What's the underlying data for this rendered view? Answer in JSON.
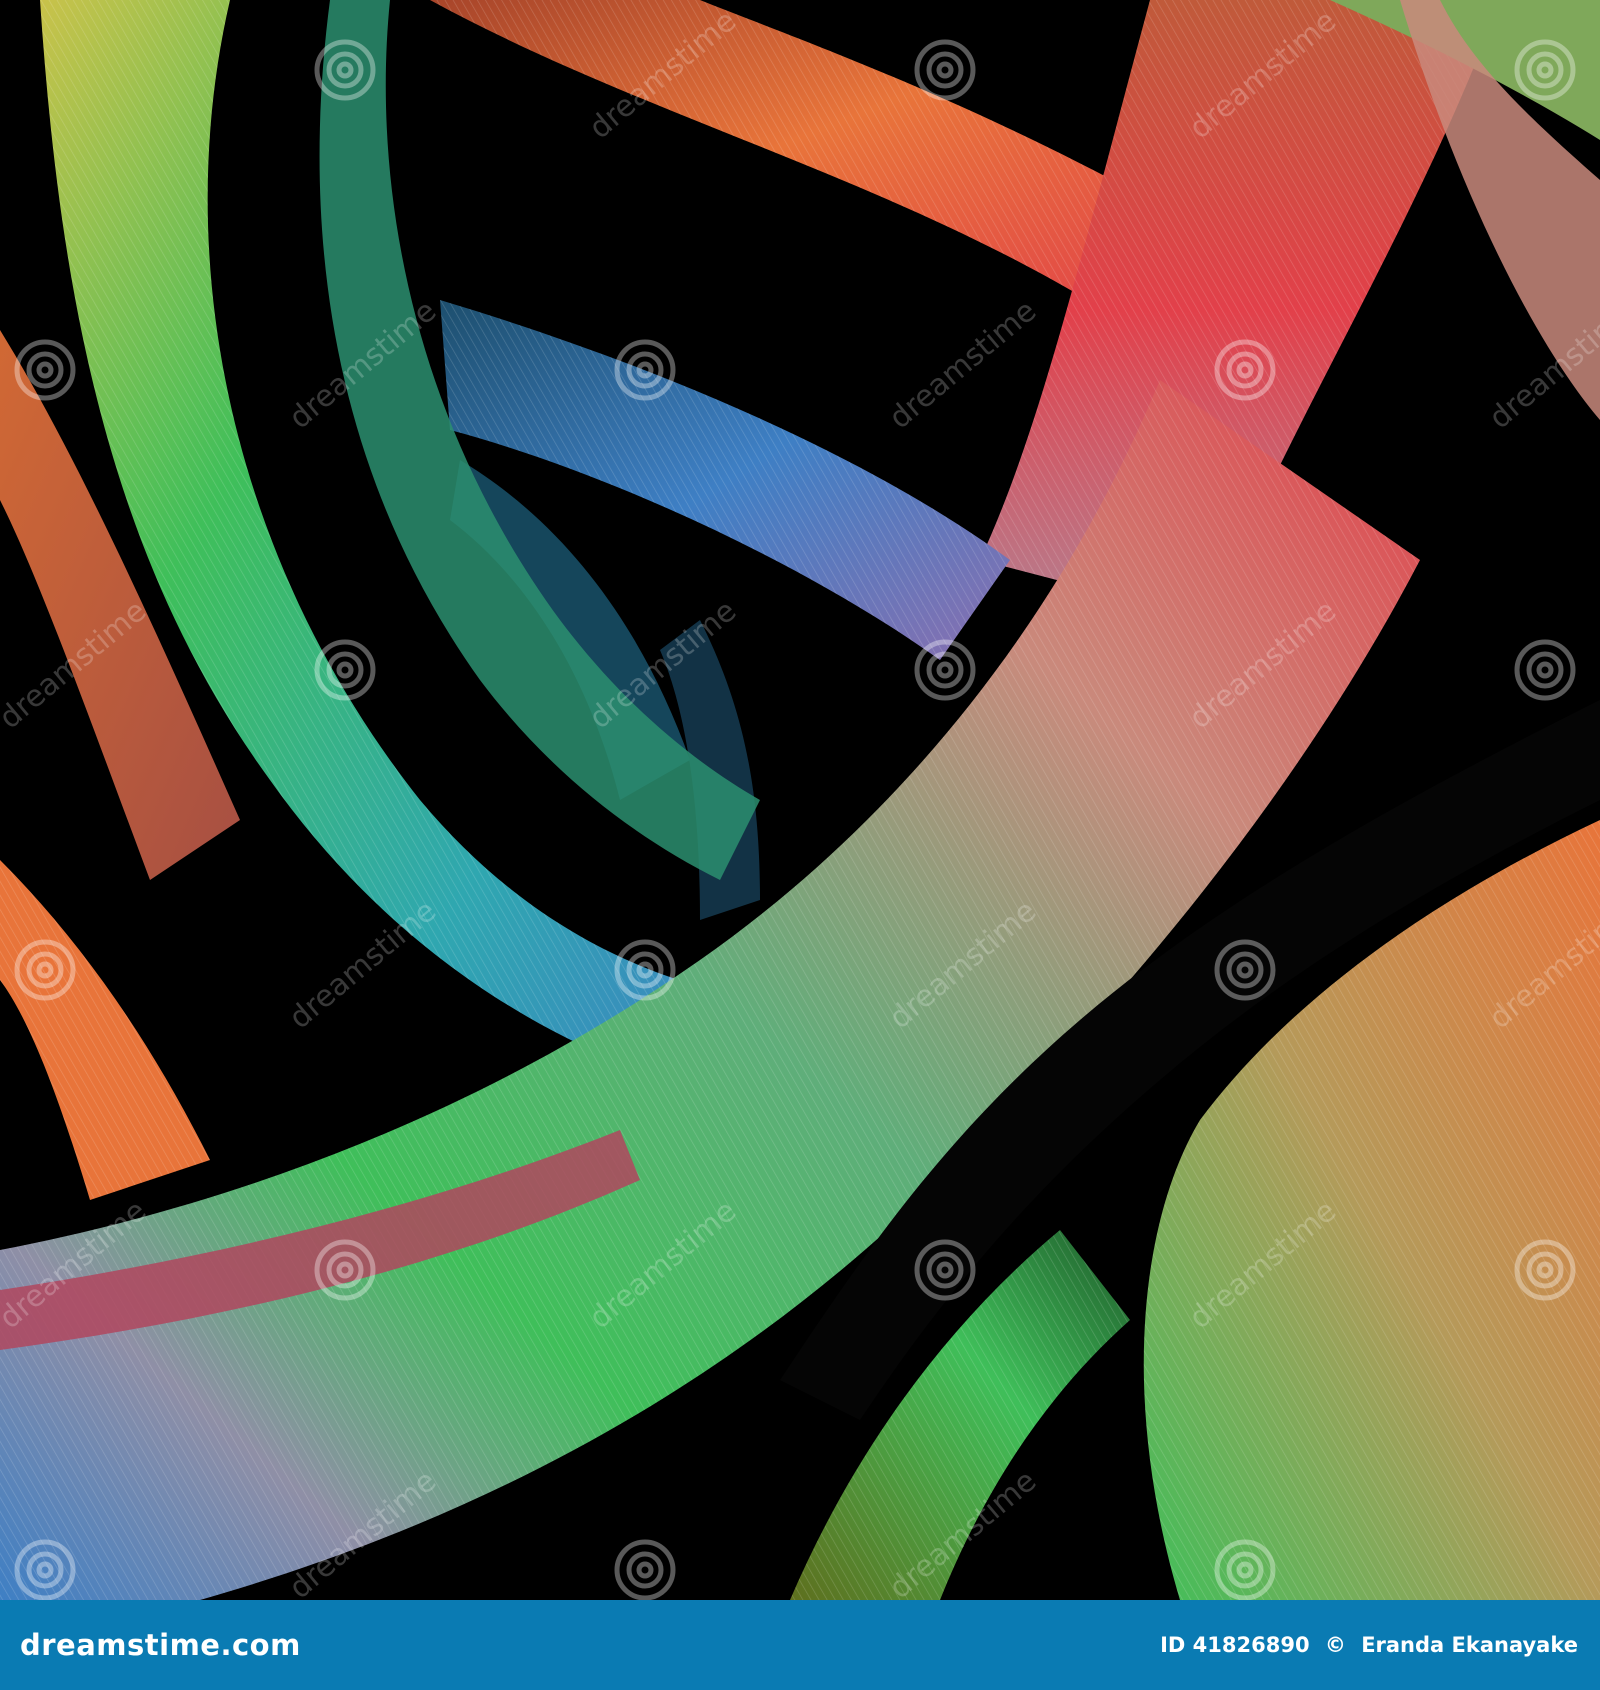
{
  "image": {
    "subject": "abstract-colorful-light-streaks",
    "colors": {
      "background": "#000000",
      "orange": "#e8743a",
      "red": "#e2404a",
      "green": "#3fbf5a",
      "teal": "#2fa7b0",
      "blue": "#3e7fc4",
      "yellow": "#c9c24a",
      "violet": "#8a6fb0"
    }
  },
  "watermark": {
    "text": "dreamstime",
    "icon": "spiral-icon"
  },
  "footer": {
    "background": "#0a7bb3",
    "text_color": "#ffffff",
    "brand": "dreamstime.com",
    "image_id": "ID 41826890",
    "copyright_symbol": "©",
    "author": "Eranda Ekanayake"
  }
}
